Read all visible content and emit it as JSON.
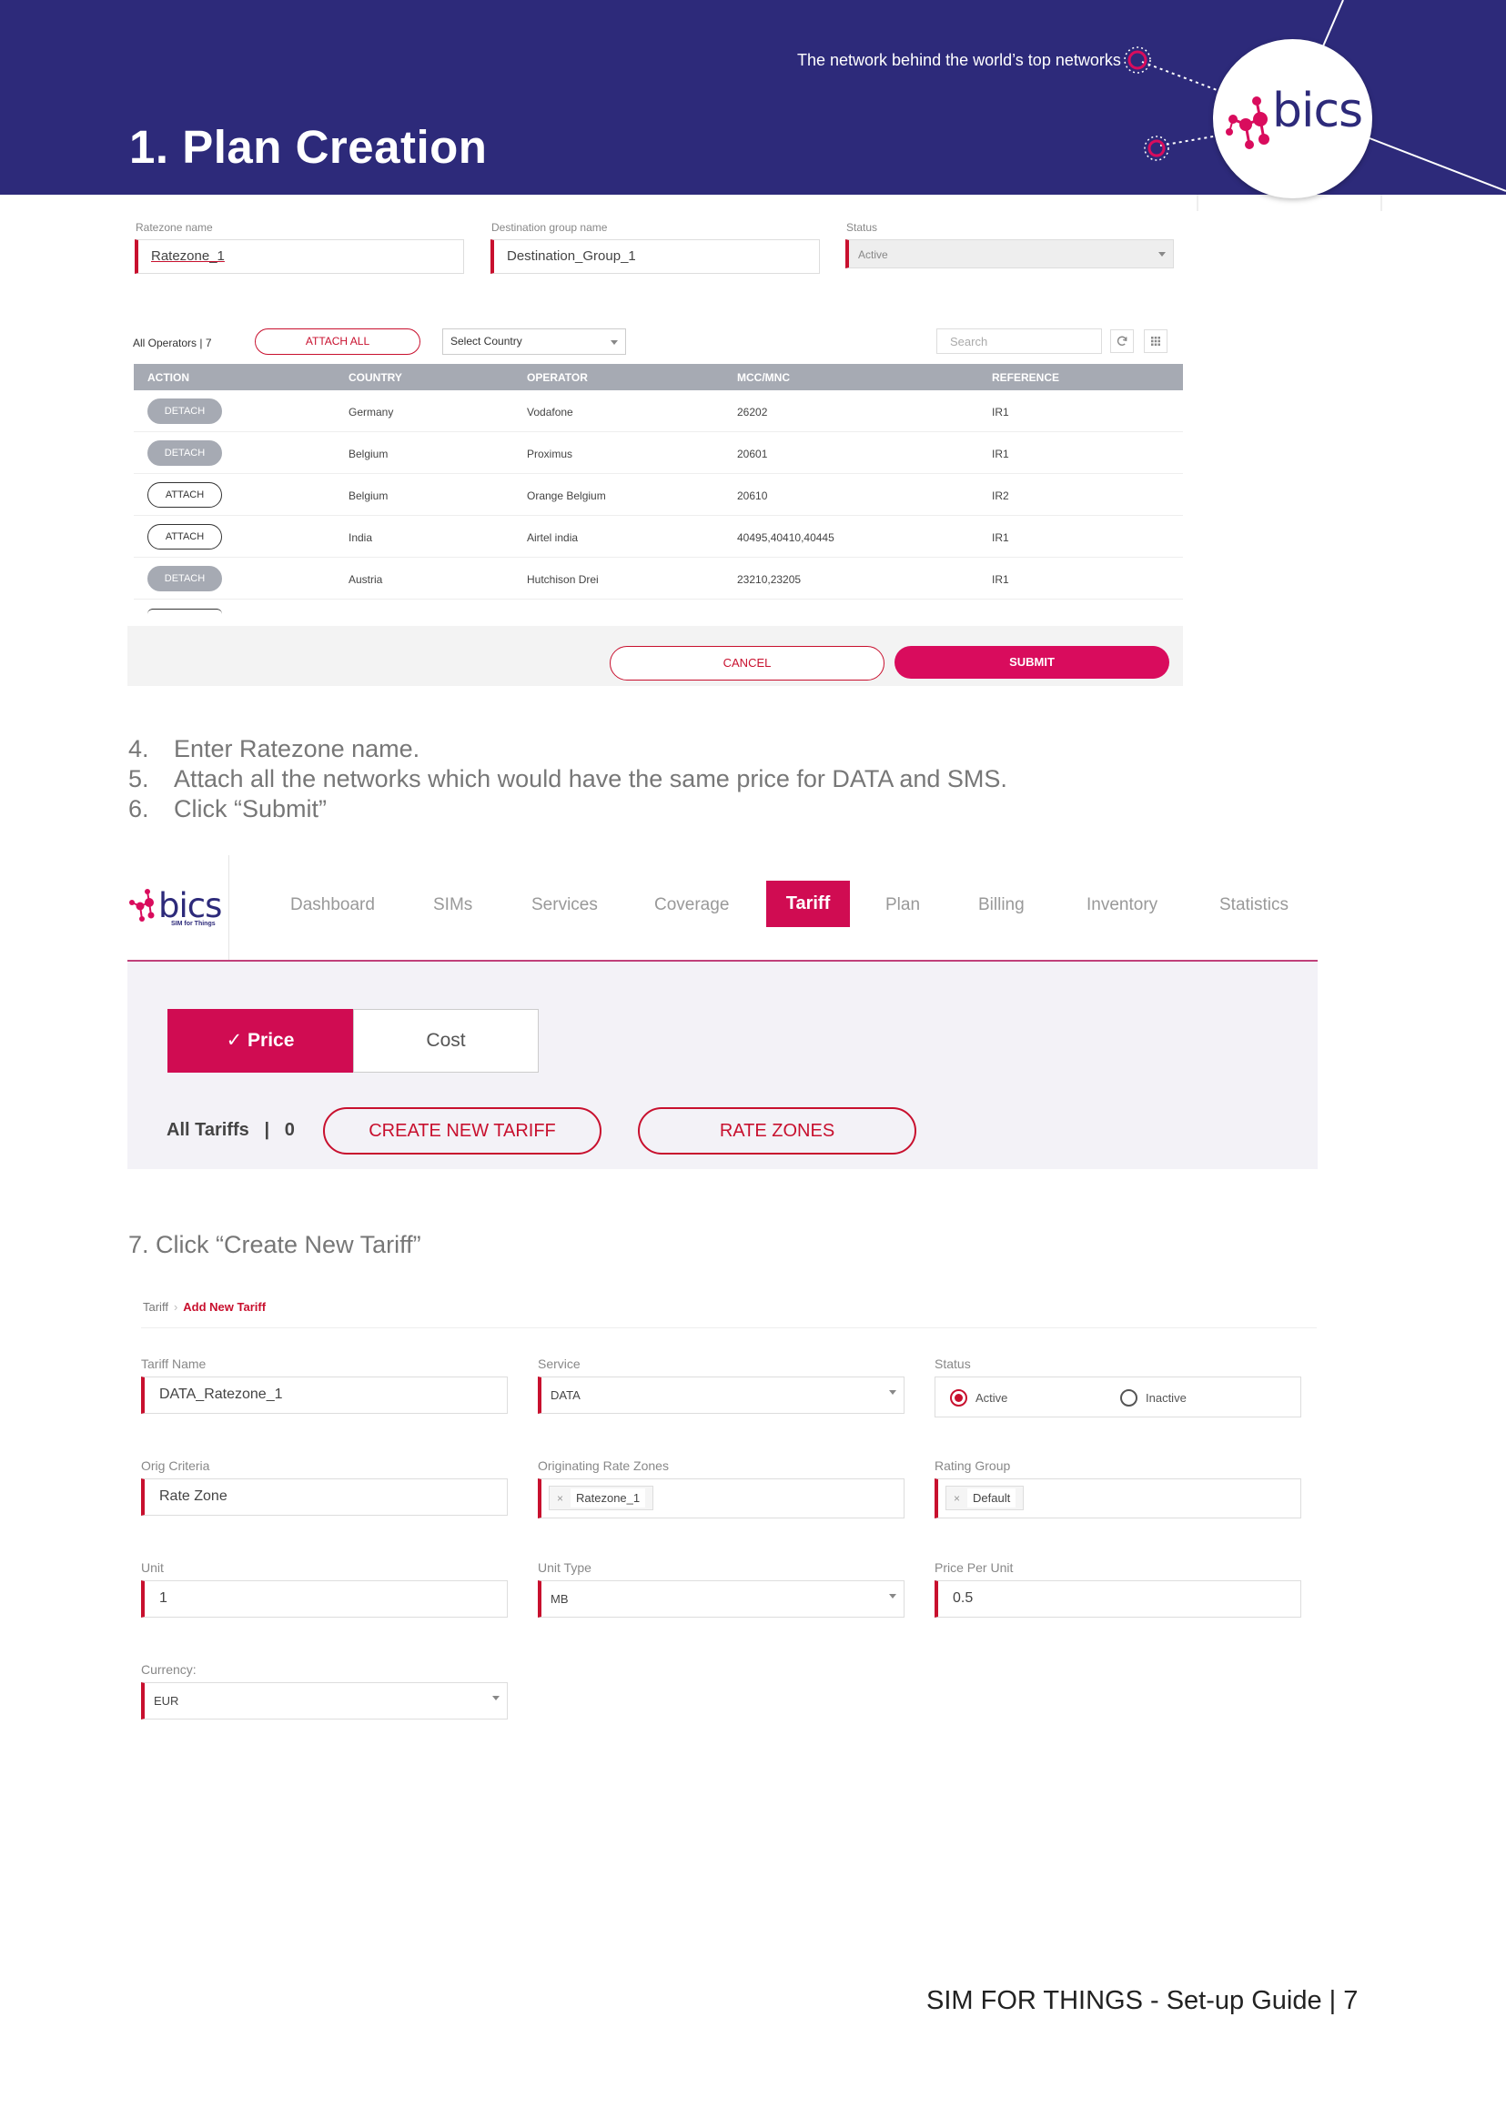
{
  "header": {
    "title": "1. Plan Creation",
    "tagline": "The network behind the world’s top networks",
    "logo_text": "bics",
    "colors": {
      "navy": "#2d2a7a",
      "accent": "#c8102e",
      "magenta": "#d00c52"
    }
  },
  "ratezone_form": {
    "ratezone_label": "Ratezone name",
    "ratezone_value": "Ratezone_1",
    "destination_label": "Destination group name",
    "destination_value": "Destination_Group_1",
    "status_label": "Status",
    "status_value": "Active",
    "all_operators_label": "All Operators",
    "all_operators_count": "7",
    "attach_all_label": "ATTACH ALL",
    "select_country_label": "Select Country",
    "search_placeholder": "Search",
    "refresh_icon": "refresh-icon",
    "grid_icon": "grid-icon",
    "columns": [
      "ACTION",
      "COUNTRY",
      "OPERATOR",
      "MCC/MNC",
      "REFERENCE"
    ],
    "rows": [
      {
        "action": "DETACH",
        "country": "Germany",
        "operator": "Vodafone",
        "mccmnc": "26202",
        "reference": "IR1"
      },
      {
        "action": "DETACH",
        "country": "Belgium",
        "operator": "Proximus",
        "mccmnc": "20601",
        "reference": "IR1"
      },
      {
        "action": "ATTACH",
        "country": "Belgium",
        "operator": "Orange Belgium",
        "mccmnc": "20610",
        "reference": "IR2"
      },
      {
        "action": "ATTACH",
        "country": "India",
        "operator": "Airtel india",
        "mccmnc": "40495,40410,40445",
        "reference": "IR1"
      },
      {
        "action": "DETACH",
        "country": "Austria",
        "operator": "Hutchison Drei",
        "mccmnc": "23210,23205",
        "reference": "IR1"
      }
    ],
    "cancel_label": "CANCEL",
    "submit_label": "SUBMIT"
  },
  "steps": [
    {
      "num": "4.",
      "text": "Enter Ratezone name."
    },
    {
      "num": "5.",
      "text": "Attach all the networks which would have the same price for DATA and SMS."
    },
    {
      "num": "6.",
      "text": "Click “Submit”"
    }
  ],
  "step7": "7. Click “Create New Tariff”",
  "tariff_nav": {
    "logo_text": "bics",
    "logo_sub": "SIM for Things",
    "items": [
      "Dashboard",
      "SIMs",
      "Services",
      "Coverage",
      "Tariff",
      "Plan",
      "Billing",
      "Inventory",
      "Statistics"
    ],
    "active_item": "Tariff",
    "price_label": "✓ Price",
    "cost_label": "Cost",
    "all_tariffs_label": "All Tariffs",
    "all_tariffs_count": "0",
    "create_label": "CREATE NEW TARIFF",
    "rate_zones_label": "RATE ZONES"
  },
  "tariff_form": {
    "breadcrumb_root": "Tariff",
    "breadcrumb_current": "Add New Tariff",
    "tariff_name_label": "Tariff Name",
    "tariff_name_value": "DATA_Ratezone_1",
    "service_label": "Service",
    "service_value": "DATA",
    "status_label": "Status",
    "status_active": "Active",
    "status_inactive": "Inactive",
    "orig_criteria_label": "Orig Criteria",
    "orig_criteria_value": "Rate Zone",
    "orig_rate_zones_label": "Originating Rate Zones",
    "orig_rate_zones_chip": "Ratezone_1",
    "rating_group_label": "Rating Group",
    "rating_group_chip": "Default",
    "unit_label": "Unit",
    "unit_value": "1",
    "unit_type_label": "Unit Type",
    "unit_type_value": "MB",
    "price_per_unit_label": "Price Per Unit",
    "price_per_unit_value": "0.5",
    "currency_label": "Currency:",
    "currency_value": "EUR"
  },
  "footer": {
    "text": "SIM FOR THINGS - Set-up Guide | 7"
  }
}
